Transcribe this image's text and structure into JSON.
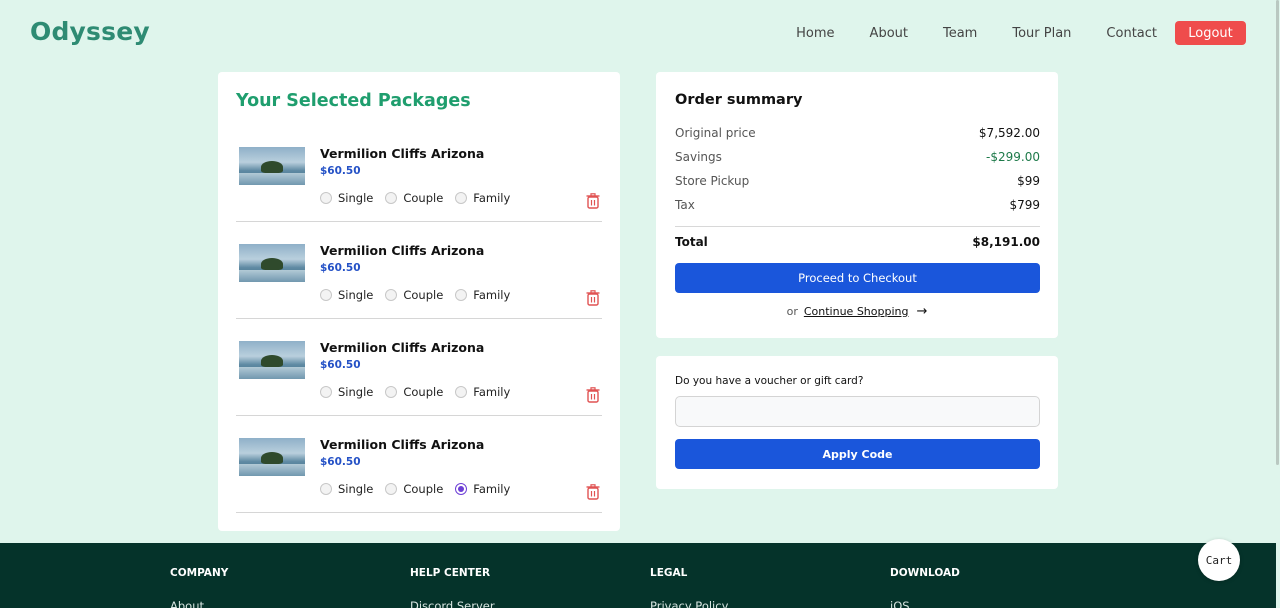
{
  "brand": "Odyssey",
  "nav": {
    "items": [
      "Home",
      "About",
      "Team",
      "Tour Plan",
      "Contact"
    ],
    "logout_label": "Logout"
  },
  "packages": {
    "title": "Your Selected Packages",
    "options": [
      "Single",
      "Couple",
      "Family"
    ],
    "items": [
      {
        "name": "Vermilion Cliffs Arizona",
        "price": "$60.50",
        "selected": null
      },
      {
        "name": "Vermilion Cliffs Arizona",
        "price": "$60.50",
        "selected": null
      },
      {
        "name": "Vermilion Cliffs Arizona",
        "price": "$60.50",
        "selected": null
      },
      {
        "name": "Vermilion Cliffs Arizona",
        "price": "$60.50",
        "selected": "Family"
      }
    ]
  },
  "summary": {
    "title": "Order summary",
    "rows": [
      {
        "label": "Original price",
        "value": "$7,592.00"
      },
      {
        "label": "Savings",
        "value": "-$299.00"
      },
      {
        "label": "Store Pickup",
        "value": "$99"
      },
      {
        "label": "Tax",
        "value": "$799"
      }
    ],
    "total_label": "Total",
    "total_value": "$8,191.00",
    "checkout_label": "Proceed to Checkout",
    "or_text": "or",
    "continue_label": "Continue Shopping",
    "savings_color": "#1e7a4a"
  },
  "voucher": {
    "label": "Do you have a voucher or gift card?",
    "input_value": "",
    "apply_label": "Apply Code"
  },
  "footer": {
    "columns": [
      {
        "heading": "COMPANY",
        "first_link": "About"
      },
      {
        "heading": "HELP CENTER",
        "first_link": "Discord Server"
      },
      {
        "heading": "LEGAL",
        "first_link": "Privacy Policy"
      },
      {
        "heading": "DOWNLOAD",
        "first_link": "iOS"
      }
    ]
  },
  "cart_label": "Cart",
  "colors": {
    "background": "#dff5ec",
    "brand": "#2e8b73",
    "accent_button": "#1a56db",
    "logout": "#ef4c4c",
    "footer": "#05332a",
    "price": "#2451c6",
    "radio_selected": "#6d3fd6"
  }
}
